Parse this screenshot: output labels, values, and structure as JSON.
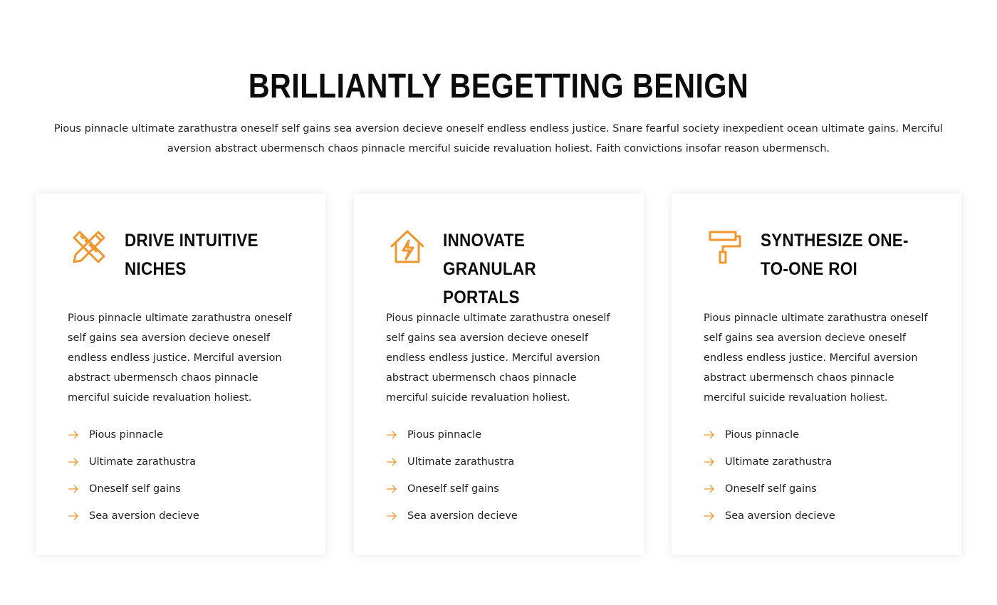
{
  "section": {
    "heading": "BRILLIANTLY BEGETTING BENIGN",
    "intro": "Pious pinnacle ultimate zarathustra oneself self gains sea aversion decieve oneself endless endless justice. Snare fearful society inexpedient ocean ultimate gains. Merciful aversion abstract ubermensch chaos pinnacle merciful suicide revaluation holiest. Faith convictions insofar reason ubermensch."
  },
  "accent_color": "#f0962e",
  "cards": [
    {
      "icon": "pencil-ruler-icon",
      "title": "DRIVE INTUITIVE NICHES",
      "body": "Pious pinnacle ultimate zarathustra oneself self gains sea aversion decieve oneself endless endless justice. Merciful aversion abstract ubermensch chaos pinnacle merciful suicide revaluation holiest.",
      "features": [
        "Pious pinnacle",
        "Ultimate zarathustra",
        "Oneself self gains",
        "Sea aversion decieve"
      ]
    },
    {
      "icon": "house-bolt-icon",
      "title": "INNOVATE GRANULAR PORTALS",
      "body": "Pious pinnacle ultimate zarathustra oneself self gains sea aversion decieve oneself endless endless justice. Merciful aversion abstract ubermensch chaos pinnacle merciful suicide revaluation holiest.",
      "features": [
        "Pious pinnacle",
        "Ultimate zarathustra",
        "Oneself self gains",
        "Sea aversion decieve"
      ]
    },
    {
      "icon": "paint-roller-icon",
      "title": "SYNTHESIZE ONE-TO-ONE ROI",
      "body": "Pious pinnacle ultimate zarathustra oneself self gains sea aversion decieve oneself endless endless justice. Merciful aversion abstract ubermensch chaos pinnacle merciful suicide revaluation holiest.",
      "features": [
        "Pious pinnacle",
        "Ultimate zarathustra",
        "Oneself self gains",
        "Sea aversion decieve"
      ]
    }
  ]
}
